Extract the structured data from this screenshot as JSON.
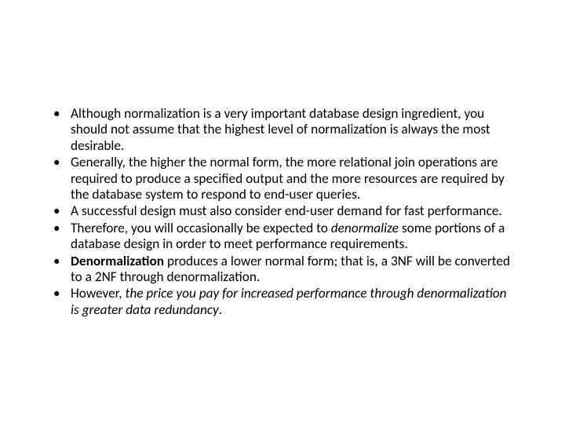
{
  "bullets": [
    {
      "plain": "Although normalization is a very important database design ingredient, you should not assume that the highest level of normalization is always the most desirable."
    },
    {
      "plain": "Generally, the higher the normal form, the more relational join operations are required to produce a specified output and the more resources are required by the database system to respond to end-user queries."
    },
    {
      "plain": "A successful design must also consider end-user demand for fast performance."
    },
    {
      "pre": "Therefore, you will occasionally be expected to ",
      "ital1": "denormalize",
      "post": " some portions of a database design in order to meet performance requirements."
    },
    {
      "space": " ",
      "bold1": "Denormalization",
      "post": " produces a lower normal form; that is, a 3NF will be converted to a 2NF through denormalization."
    },
    {
      "pre": "However, ",
      "ital1": "the price you pay for increased performance through denormalization is greater data redundancy",
      "post": "."
    }
  ]
}
